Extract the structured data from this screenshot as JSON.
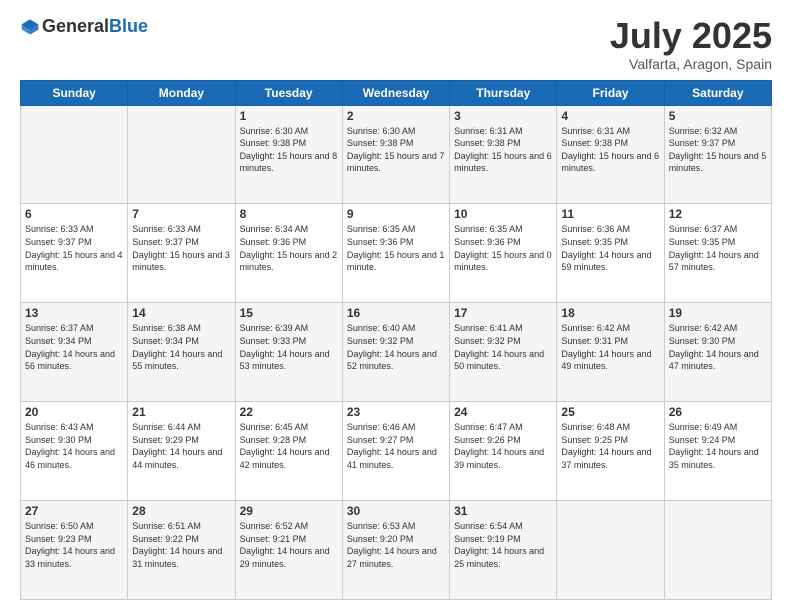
{
  "header": {
    "logo_general": "General",
    "logo_blue": "Blue",
    "month_title": "July 2025",
    "location": "Valfarta, Aragon, Spain"
  },
  "days_of_week": [
    "Sunday",
    "Monday",
    "Tuesday",
    "Wednesday",
    "Thursday",
    "Friday",
    "Saturday"
  ],
  "weeks": [
    [
      {
        "day": "",
        "info": ""
      },
      {
        "day": "",
        "info": ""
      },
      {
        "day": "1",
        "info": "Sunrise: 6:30 AM\nSunset: 9:38 PM\nDaylight: 15 hours and 8 minutes."
      },
      {
        "day": "2",
        "info": "Sunrise: 6:30 AM\nSunset: 9:38 PM\nDaylight: 15 hours and 7 minutes."
      },
      {
        "day": "3",
        "info": "Sunrise: 6:31 AM\nSunset: 9:38 PM\nDaylight: 15 hours and 6 minutes."
      },
      {
        "day": "4",
        "info": "Sunrise: 6:31 AM\nSunset: 9:38 PM\nDaylight: 15 hours and 6 minutes."
      },
      {
        "day": "5",
        "info": "Sunrise: 6:32 AM\nSunset: 9:37 PM\nDaylight: 15 hours and 5 minutes."
      }
    ],
    [
      {
        "day": "6",
        "info": "Sunrise: 6:33 AM\nSunset: 9:37 PM\nDaylight: 15 hours and 4 minutes."
      },
      {
        "day": "7",
        "info": "Sunrise: 6:33 AM\nSunset: 9:37 PM\nDaylight: 15 hours and 3 minutes."
      },
      {
        "day": "8",
        "info": "Sunrise: 6:34 AM\nSunset: 9:36 PM\nDaylight: 15 hours and 2 minutes."
      },
      {
        "day": "9",
        "info": "Sunrise: 6:35 AM\nSunset: 9:36 PM\nDaylight: 15 hours and 1 minute."
      },
      {
        "day": "10",
        "info": "Sunrise: 6:35 AM\nSunset: 9:36 PM\nDaylight: 15 hours and 0 minutes."
      },
      {
        "day": "11",
        "info": "Sunrise: 6:36 AM\nSunset: 9:35 PM\nDaylight: 14 hours and 59 minutes."
      },
      {
        "day": "12",
        "info": "Sunrise: 6:37 AM\nSunset: 9:35 PM\nDaylight: 14 hours and 57 minutes."
      }
    ],
    [
      {
        "day": "13",
        "info": "Sunrise: 6:37 AM\nSunset: 9:34 PM\nDaylight: 14 hours and 56 minutes."
      },
      {
        "day": "14",
        "info": "Sunrise: 6:38 AM\nSunset: 9:34 PM\nDaylight: 14 hours and 55 minutes."
      },
      {
        "day": "15",
        "info": "Sunrise: 6:39 AM\nSunset: 9:33 PM\nDaylight: 14 hours and 53 minutes."
      },
      {
        "day": "16",
        "info": "Sunrise: 6:40 AM\nSunset: 9:32 PM\nDaylight: 14 hours and 52 minutes."
      },
      {
        "day": "17",
        "info": "Sunrise: 6:41 AM\nSunset: 9:32 PM\nDaylight: 14 hours and 50 minutes."
      },
      {
        "day": "18",
        "info": "Sunrise: 6:42 AM\nSunset: 9:31 PM\nDaylight: 14 hours and 49 minutes."
      },
      {
        "day": "19",
        "info": "Sunrise: 6:42 AM\nSunset: 9:30 PM\nDaylight: 14 hours and 47 minutes."
      }
    ],
    [
      {
        "day": "20",
        "info": "Sunrise: 6:43 AM\nSunset: 9:30 PM\nDaylight: 14 hours and 46 minutes."
      },
      {
        "day": "21",
        "info": "Sunrise: 6:44 AM\nSunset: 9:29 PM\nDaylight: 14 hours and 44 minutes."
      },
      {
        "day": "22",
        "info": "Sunrise: 6:45 AM\nSunset: 9:28 PM\nDaylight: 14 hours and 42 minutes."
      },
      {
        "day": "23",
        "info": "Sunrise: 6:46 AM\nSunset: 9:27 PM\nDaylight: 14 hours and 41 minutes."
      },
      {
        "day": "24",
        "info": "Sunrise: 6:47 AM\nSunset: 9:26 PM\nDaylight: 14 hours and 39 minutes."
      },
      {
        "day": "25",
        "info": "Sunrise: 6:48 AM\nSunset: 9:25 PM\nDaylight: 14 hours and 37 minutes."
      },
      {
        "day": "26",
        "info": "Sunrise: 6:49 AM\nSunset: 9:24 PM\nDaylight: 14 hours and 35 minutes."
      }
    ],
    [
      {
        "day": "27",
        "info": "Sunrise: 6:50 AM\nSunset: 9:23 PM\nDaylight: 14 hours and 33 minutes."
      },
      {
        "day": "28",
        "info": "Sunrise: 6:51 AM\nSunset: 9:22 PM\nDaylight: 14 hours and 31 minutes."
      },
      {
        "day": "29",
        "info": "Sunrise: 6:52 AM\nSunset: 9:21 PM\nDaylight: 14 hours and 29 minutes."
      },
      {
        "day": "30",
        "info": "Sunrise: 6:53 AM\nSunset: 9:20 PM\nDaylight: 14 hours and 27 minutes."
      },
      {
        "day": "31",
        "info": "Sunrise: 6:54 AM\nSunset: 9:19 PM\nDaylight: 14 hours and 25 minutes."
      },
      {
        "day": "",
        "info": ""
      },
      {
        "day": "",
        "info": ""
      }
    ]
  ]
}
